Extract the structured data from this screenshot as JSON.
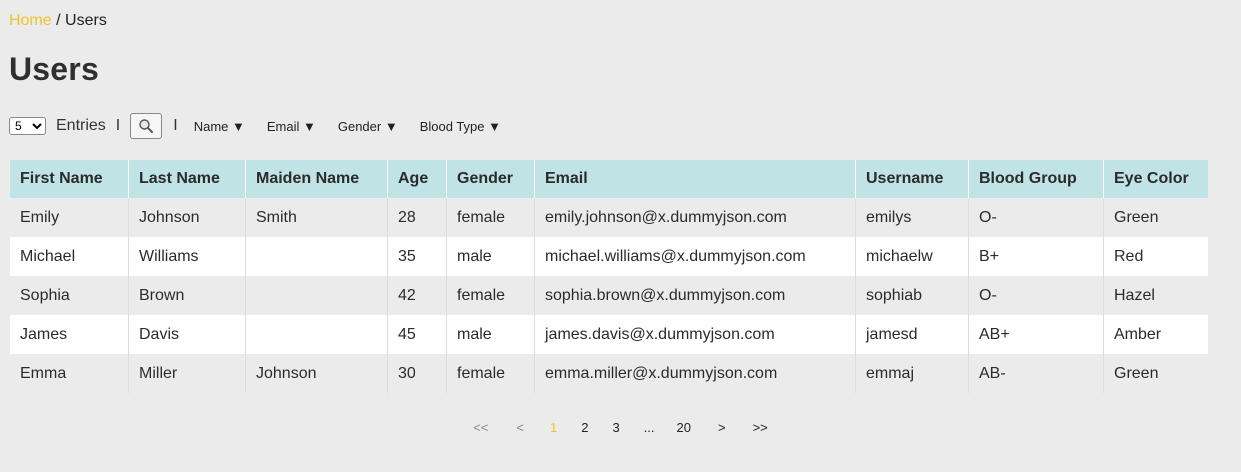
{
  "breadcrumb": {
    "home": "Home",
    "separator": "/",
    "current": "Users"
  },
  "page_title": "Users",
  "controls": {
    "entries_value": "5",
    "entries_options": [
      "5"
    ],
    "entries_label": "Entries",
    "pipe": "I",
    "search_icon": "magnifier-icon",
    "filters": [
      "Name ▼",
      "Email ▼",
      "Gender ▼",
      "Blood Type ▼"
    ]
  },
  "table": {
    "columns": [
      "First Name",
      "Last Name",
      "Maiden Name",
      "Age",
      "Gender",
      "Email",
      "Username",
      "Blood Group",
      "Eye Color"
    ],
    "rows": [
      [
        "Emily",
        "Johnson",
        "Smith",
        "28",
        "female",
        "emily.johnson@x.dummyjson.com",
        "emilys",
        "O-",
        "Green"
      ],
      [
        "Michael",
        "Williams",
        "",
        "35",
        "male",
        "michael.williams@x.dummyjson.com",
        "michaelw",
        "B+",
        "Red"
      ],
      [
        "Sophia",
        "Brown",
        "",
        "42",
        "female",
        "sophia.brown@x.dummyjson.com",
        "sophiab",
        "O-",
        "Hazel"
      ],
      [
        "James",
        "Davis",
        "",
        "45",
        "male",
        "james.davis@x.dummyjson.com",
        "jamesd",
        "AB+",
        "Amber"
      ],
      [
        "Emma",
        "Miller",
        "Johnson",
        "30",
        "female",
        "emma.miller@x.dummyjson.com",
        "emmaj",
        "AB-",
        "Green"
      ]
    ]
  },
  "pagination": {
    "first": "<<",
    "prev": "<",
    "pages": [
      "1",
      "2",
      "3"
    ],
    "ellipsis": "...",
    "last_page": "20",
    "next": ">",
    "last": ">>",
    "active": "1"
  },
  "colors": {
    "accent": "#f2c12e",
    "header_bg": "#c0e3e5",
    "page_bg": "#ebebeb"
  }
}
